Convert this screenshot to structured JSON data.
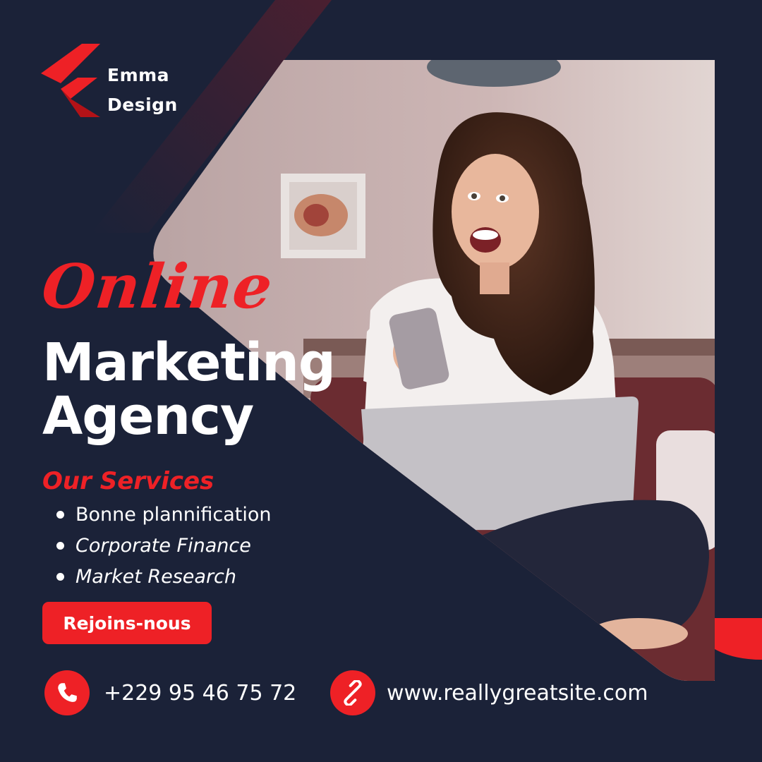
{
  "brand": {
    "name_line1": "Emma",
    "name_line2": "Design",
    "logo_icon": "chevron-logo-icon"
  },
  "headline": {
    "script": "Online",
    "line1": "Marketing",
    "line2": "Agency"
  },
  "services": {
    "title": "Our Services",
    "items": [
      "Bonne plannification",
      "Corporate Finance",
      "Market Research"
    ]
  },
  "cta": {
    "label": "Rejoins-nous"
  },
  "contact": {
    "phone": "+229 95 46 75 72",
    "phone_icon": "phone-icon",
    "website": "www.reallygreatsite.com",
    "website_icon": "link-icon"
  },
  "colors": {
    "background": "#1b2238",
    "accent": "#ee2126",
    "text": "#ffffff"
  }
}
